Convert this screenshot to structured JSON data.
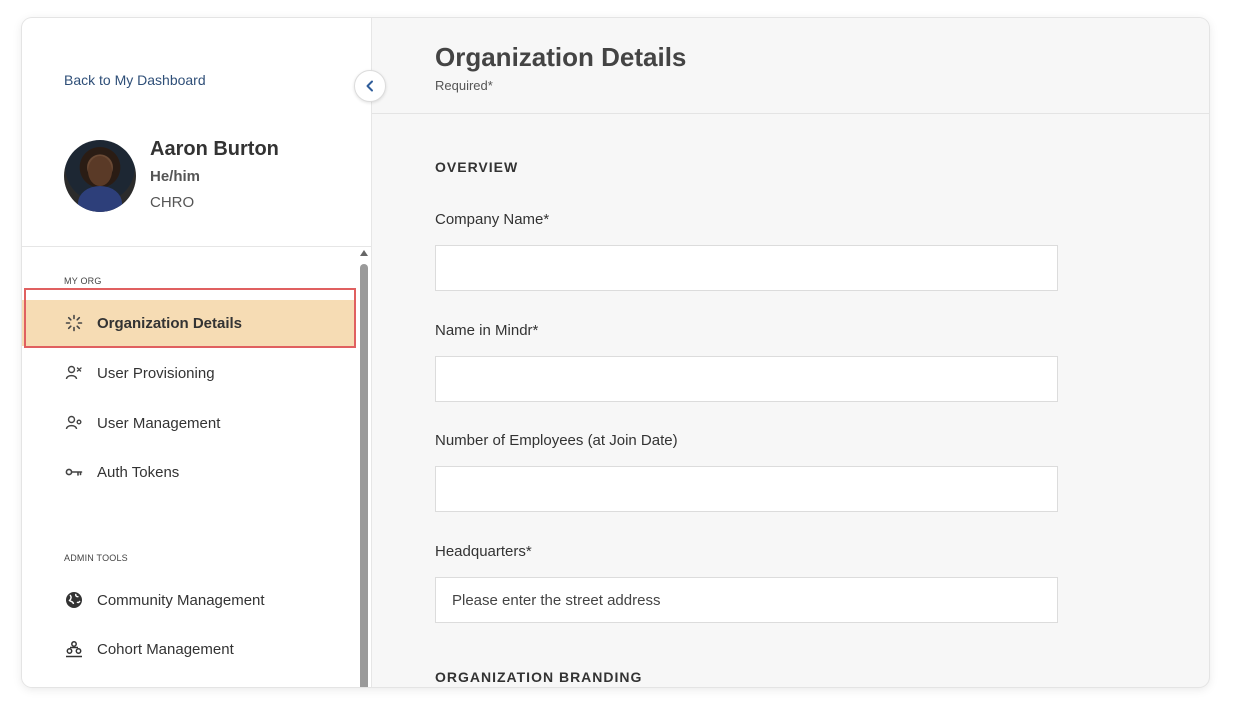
{
  "sidebar": {
    "back_link": "Back to My Dashboard",
    "profile": {
      "name": "Aaron Burton",
      "pronouns": "He/him",
      "role": "CHRO"
    },
    "sections": [
      {
        "label": "MY ORG",
        "items": [
          {
            "label": "Organization Details",
            "icon": "loader-icon",
            "active": true
          },
          {
            "label": "User Provisioning",
            "icon": "user-provisioning-icon"
          },
          {
            "label": "User Management",
            "icon": "user-management-icon"
          },
          {
            "label": "Auth Tokens",
            "icon": "key-icon"
          }
        ]
      },
      {
        "label": "ADMIN TOOLS",
        "items": [
          {
            "label": "Community Management",
            "icon": "globe-icon"
          },
          {
            "label": "Cohort Management",
            "icon": "cohort-icon"
          }
        ]
      }
    ]
  },
  "main": {
    "title": "Organization Details",
    "subtitle": "Required*",
    "sections": [
      {
        "heading": "OVERVIEW"
      },
      {
        "heading": "ORGANIZATION BRANDING"
      }
    ],
    "fields": [
      {
        "label": "Company Name*",
        "value": "",
        "placeholder": ""
      },
      {
        "label": "Name in Mindr*",
        "value": "",
        "placeholder": ""
      },
      {
        "label": "Number of Employees (at Join Date)",
        "value": "",
        "placeholder": ""
      },
      {
        "label": "Headquarters*",
        "value": "",
        "placeholder": "Please enter the street address"
      }
    ]
  },
  "colors": {
    "active_bg": "#f6dcb4",
    "highlight_border": "#e06060",
    "link": "#2f4f78"
  }
}
